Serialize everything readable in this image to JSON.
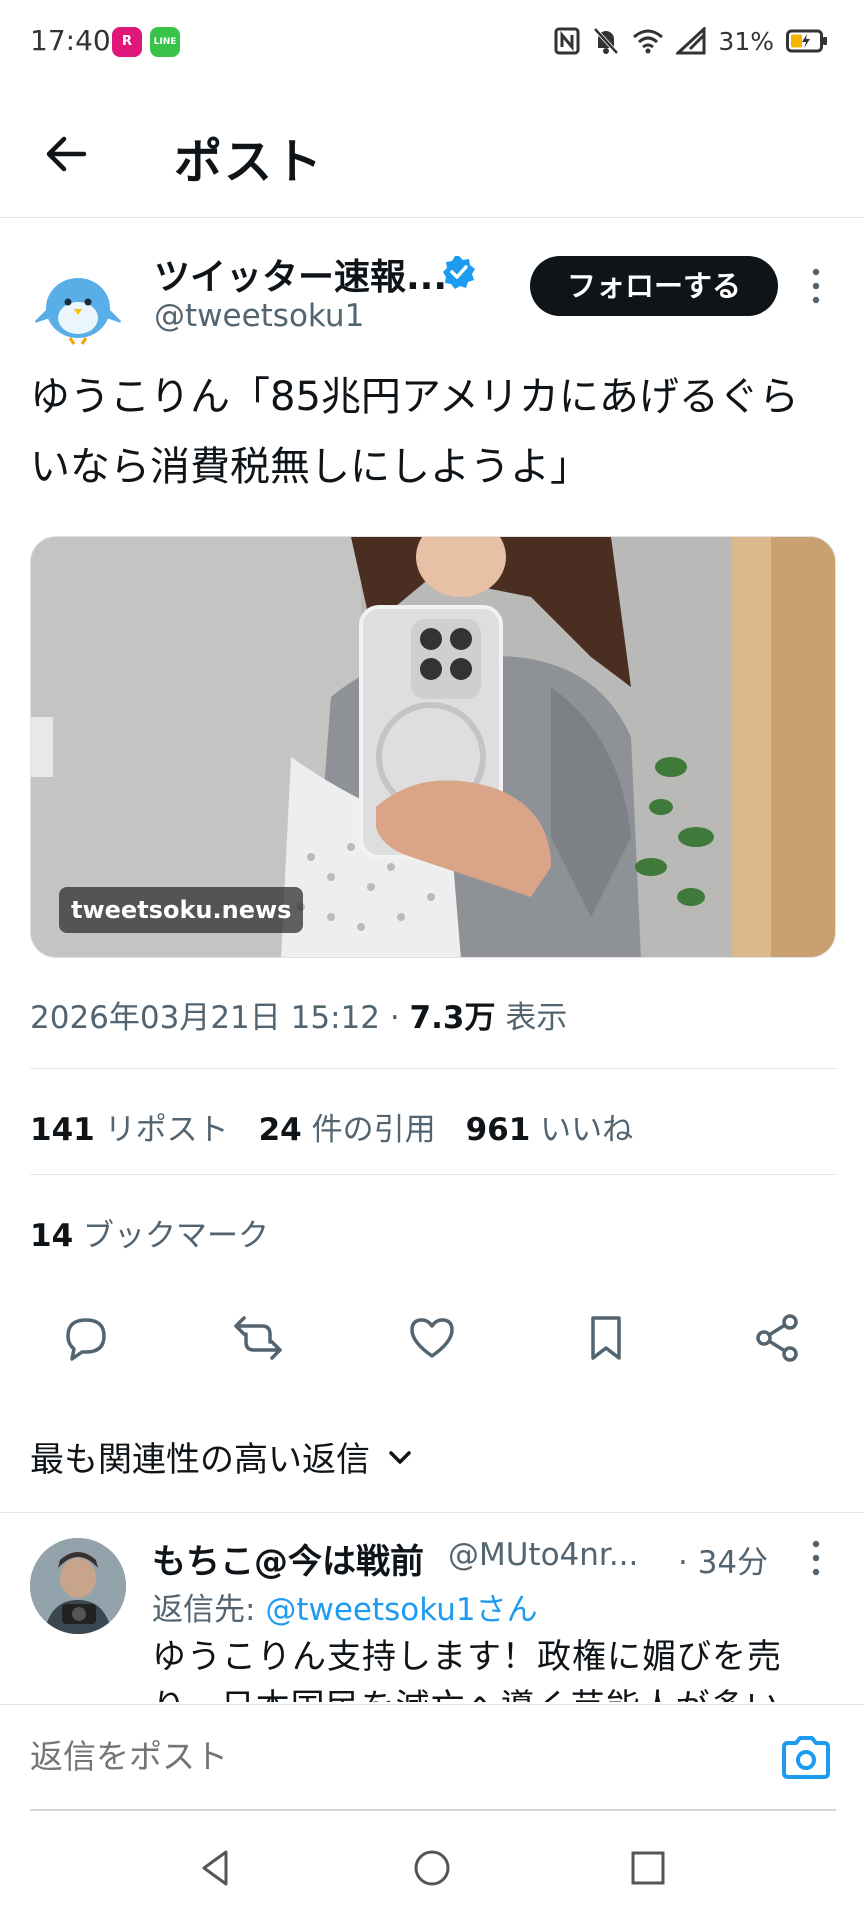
{
  "status_bar": {
    "time": "17:40",
    "app_icons": [
      {
        "name": "rakuten-icon",
        "color": "#e0177b",
        "label": "R"
      },
      {
        "name": "line-icon",
        "color": "#3ac34a",
        "label": "LINE"
      }
    ],
    "battery_percent": "31%"
  },
  "header": {
    "title": "ポスト"
  },
  "tweet": {
    "author_name": "ツイッター速報...",
    "author_handle": "@tweetsoku1",
    "follow_label": "フォローする",
    "text": "ゆうこりん「85兆円アメリカにあげるぐらいなら消費税無しにしようよ」",
    "media_watermark": "tweetsoku.news",
    "timestamp": "2026年03月21日 15:12 · ",
    "views_count": "7.3万",
    "views_label": " 表示",
    "stats": [
      {
        "count": "141",
        "label": "リポスト"
      },
      {
        "count": "24",
        "label": "件の引用"
      },
      {
        "count": "961",
        "label": "いいね"
      }
    ],
    "bookmark_count": "14",
    "bookmark_label": "ブックマーク"
  },
  "replies_sort": {
    "label": "最も関連性の高い返信"
  },
  "reply": {
    "name": "もちこ@今は戦前",
    "handle": "@MUto4nr...",
    "time": "· 34分",
    "reply_to_prefix": "返信先: ",
    "reply_to_handle": "@tweetsoku1さん",
    "text": "ゆうこりん支持します！政権に媚びを売り、日本国民を滅亡へ導く芸能人が多い"
  },
  "composer": {
    "placeholder": "返信をポスト"
  },
  "colors": {
    "accent": "#1d9bf0",
    "text_primary": "#0f1419",
    "text_secondary": "#536471"
  }
}
